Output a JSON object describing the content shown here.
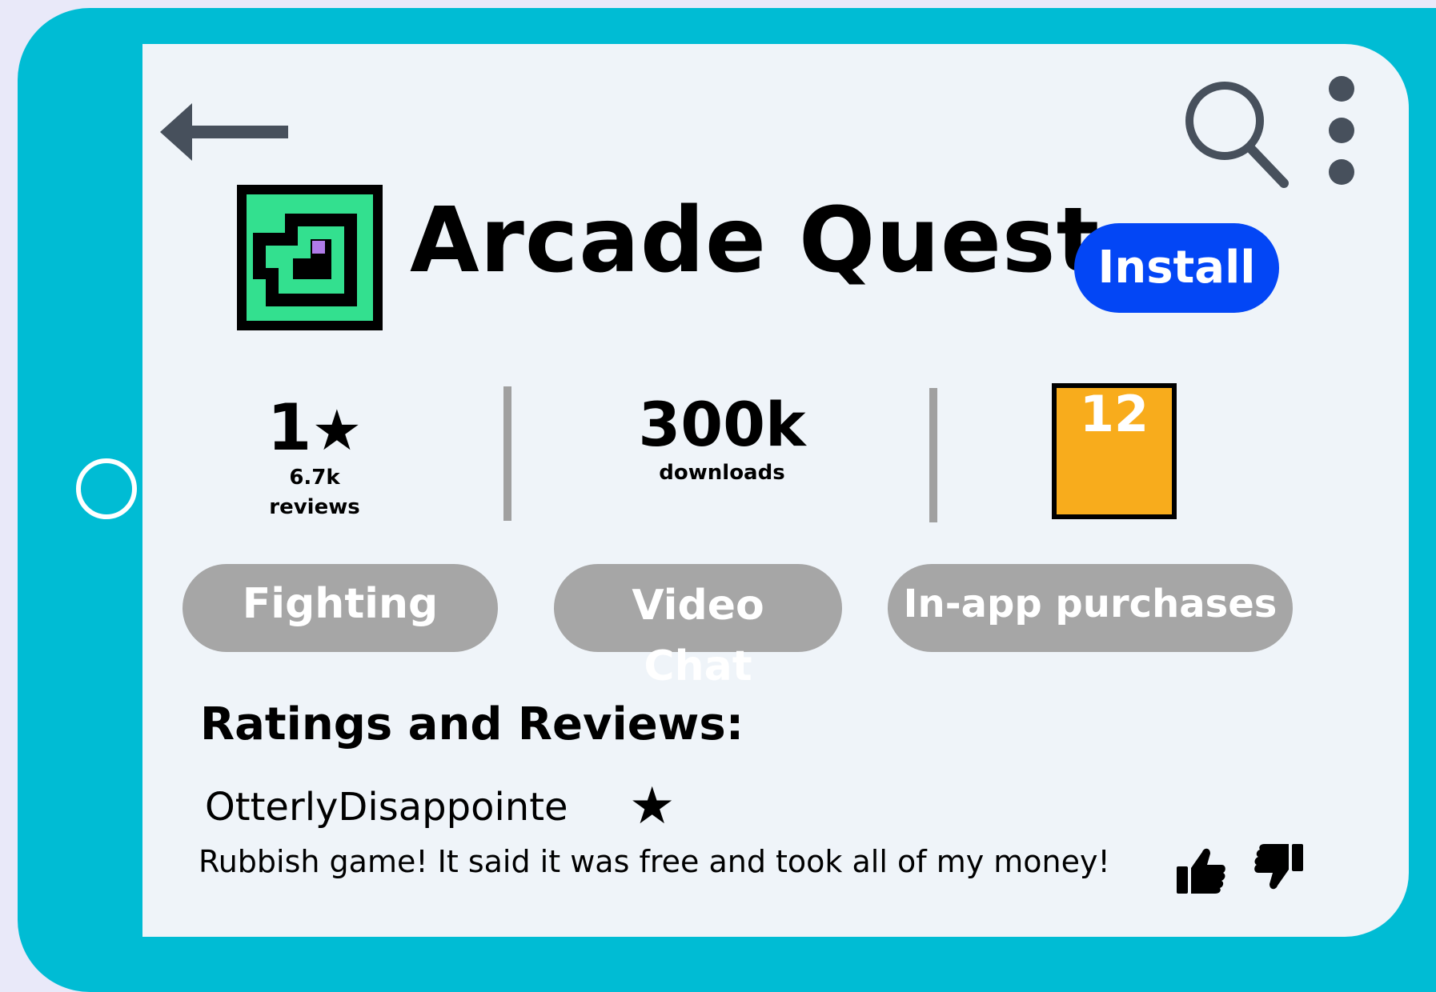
{
  "app": {
    "title": "Arcade Quest",
    "install_label": "Install"
  },
  "stats": {
    "rating_value": "1",
    "rating_star": "★",
    "reviews_count": "6.7k",
    "reviews_label": "reviews",
    "downloads_value": "300k",
    "downloads_label": "downloads",
    "age_rating": "12"
  },
  "tags": [
    "Fighting",
    "Video Chat",
    "In-app purchases"
  ],
  "reviews_section": {
    "heading": "Ratings and Reviews:",
    "items": [
      {
        "author": "OtterlyDisappointe",
        "star": "★",
        "text": "Rubbish game! It said it was free and took all of my money!"
      }
    ]
  },
  "icons": {
    "back": "back-arrow-icon",
    "search": "search-icon",
    "menu": "more-vertical-icon",
    "thumbs_up": "thumbs-up-icon",
    "thumbs_down": "thumbs-down-icon"
  },
  "colors": {
    "tablet_frame": "#00bcd4",
    "install_button": "#0346f5",
    "tag_background": "#a6a6a6",
    "age_badge": "#f8ac1c",
    "app_icon_green": "#33e08f"
  }
}
